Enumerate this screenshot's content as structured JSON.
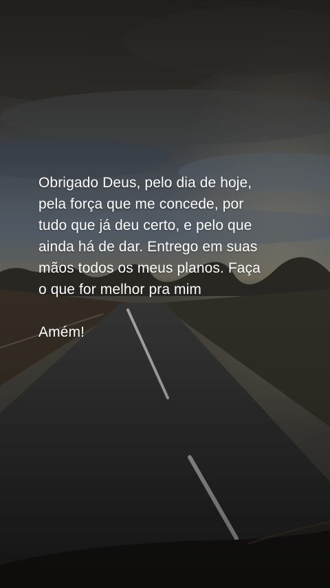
{
  "quote": {
    "lines": [
      "Obrigado Deus, pelo dia de hoje,",
      "pela força que me concede, por",
      "tudo que já deu certo, e pelo que",
      "ainda há de dar. Entrego em suas",
      "mãos todos os meus planos. Faça",
      "o que for melhor pra mim"
    ],
    "closing": "Amém!"
  },
  "colors": {
    "text": "#ffffff",
    "sky_top": "#2f2d2a",
    "sky_mid": "#4f5863",
    "horizon": "#6c6a5f",
    "road": "#2b2b2b"
  }
}
